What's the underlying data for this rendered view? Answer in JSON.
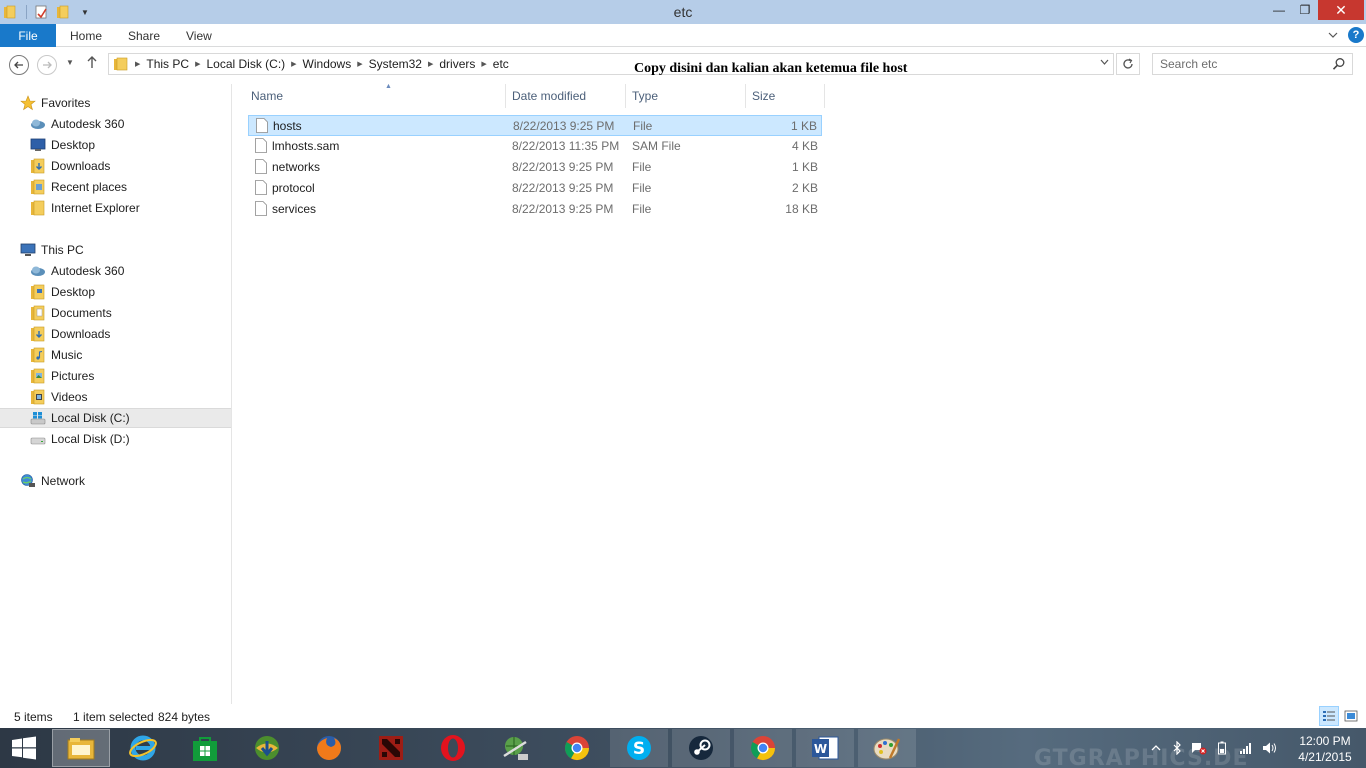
{
  "window": {
    "title": "etc",
    "minimize_glyph": "—",
    "maximize_glyph": "❐",
    "close_glyph": "✕"
  },
  "ribbon": {
    "tabs": [
      {
        "label": "File"
      },
      {
        "label": "Home"
      },
      {
        "label": "Share"
      },
      {
        "label": "View"
      }
    ],
    "help_glyph": "?"
  },
  "navigation": {
    "breadcrumb": [
      "This PC",
      "Local Disk (C:)",
      "Windows",
      "System32",
      "drivers",
      "etc"
    ],
    "search_placeholder": "Search etc"
  },
  "annotation": "Copy disini dan kalian akan ketemua file host",
  "sidebar": {
    "favorites": {
      "label": "Favorites",
      "items": [
        "Autodesk 360",
        "Desktop",
        "Downloads",
        "Recent places",
        "Internet Explorer"
      ]
    },
    "this_pc": {
      "label": "This PC",
      "items": [
        "Autodesk 360",
        "Desktop",
        "Documents",
        "Downloads",
        "Music",
        "Pictures",
        "Videos",
        "Local Disk (C:)",
        "Local Disk (D:)"
      ],
      "selected": "Local Disk (C:)"
    },
    "network": {
      "label": "Network"
    }
  },
  "file_list": {
    "columns": [
      "Name",
      "Date modified",
      "Type",
      "Size"
    ],
    "rows": [
      {
        "name": "hosts",
        "date": "8/22/2013 9:25 PM",
        "type": "File",
        "size": "1 KB",
        "selected": true
      },
      {
        "name": "lmhosts.sam",
        "date": "8/22/2013 11:35 PM",
        "type": "SAM File",
        "size": "4 KB"
      },
      {
        "name": "networks",
        "date": "8/22/2013 9:25 PM",
        "type": "File",
        "size": "1 KB"
      },
      {
        "name": "protocol",
        "date": "8/22/2013 9:25 PM",
        "type": "File",
        "size": "2 KB"
      },
      {
        "name": "services",
        "date": "8/22/2013 9:25 PM",
        "type": "File",
        "size": "18 KB"
      }
    ]
  },
  "status": {
    "item_count": "5 items",
    "selection": "1 item selected",
    "selection_size": "824 bytes"
  },
  "taskbar": {
    "apps": [
      "File Explorer",
      "Internet Explorer",
      "Store",
      "Internet Download Manager",
      "Firefox",
      "Dota 2",
      "Opera",
      "Network Monitor",
      "Chrome",
      "Skype",
      "Steam",
      "Chrome",
      "Word",
      "Paint"
    ],
    "watermark": "GTGRAPHICS.DE",
    "time": "12:00 PM",
    "date": "4/21/2015"
  },
  "colors": {
    "title_bar": "#b6cde8",
    "file_tab": "#1979ca",
    "close_button": "#c7372f",
    "selection": "#cce8ff",
    "selection_border": "#99d1ff",
    "column_header_text": "#4c607a"
  }
}
